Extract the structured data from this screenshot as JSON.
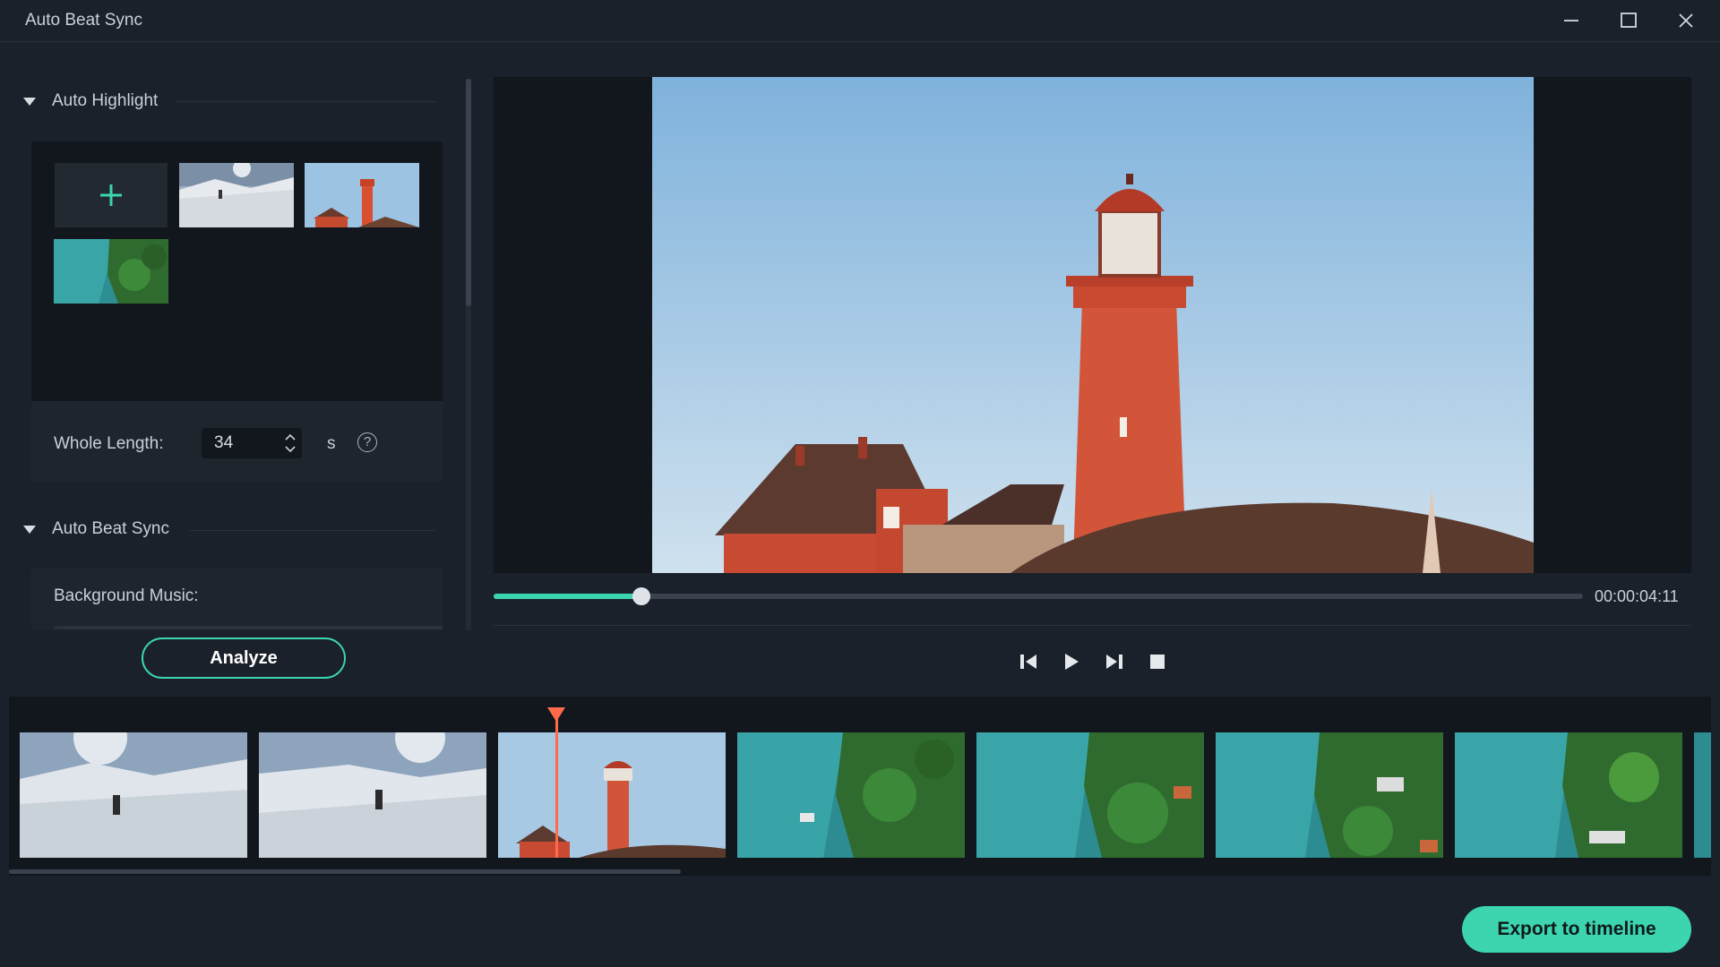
{
  "window": {
    "title": "Auto Beat Sync"
  },
  "auto_highlight": {
    "heading": "Auto Highlight",
    "media": [
      "add-media",
      "ski-clip",
      "lighthouse-clip",
      "coast-aerial-clip"
    ],
    "whole_length_label": "Whole Length:",
    "whole_length_value": "34",
    "unit": "s",
    "help": "?"
  },
  "auto_beat_sync": {
    "heading": "Auto Beat Sync",
    "background_music_label": "Background Music:"
  },
  "analyze_button": "Analyze",
  "player": {
    "timecode": "00:00:04:11",
    "progress_fraction": 0.136
  },
  "timeline": {
    "clips": [
      "ski-1",
      "ski-2",
      "lighthouse",
      "coast-1",
      "coast-2",
      "coast-3",
      "coast-4"
    ]
  },
  "export_button": "Export to timeline",
  "colors": {
    "accent": "#3cd5b0",
    "playhead": "#ff6b4a",
    "background": "#1b212a"
  }
}
